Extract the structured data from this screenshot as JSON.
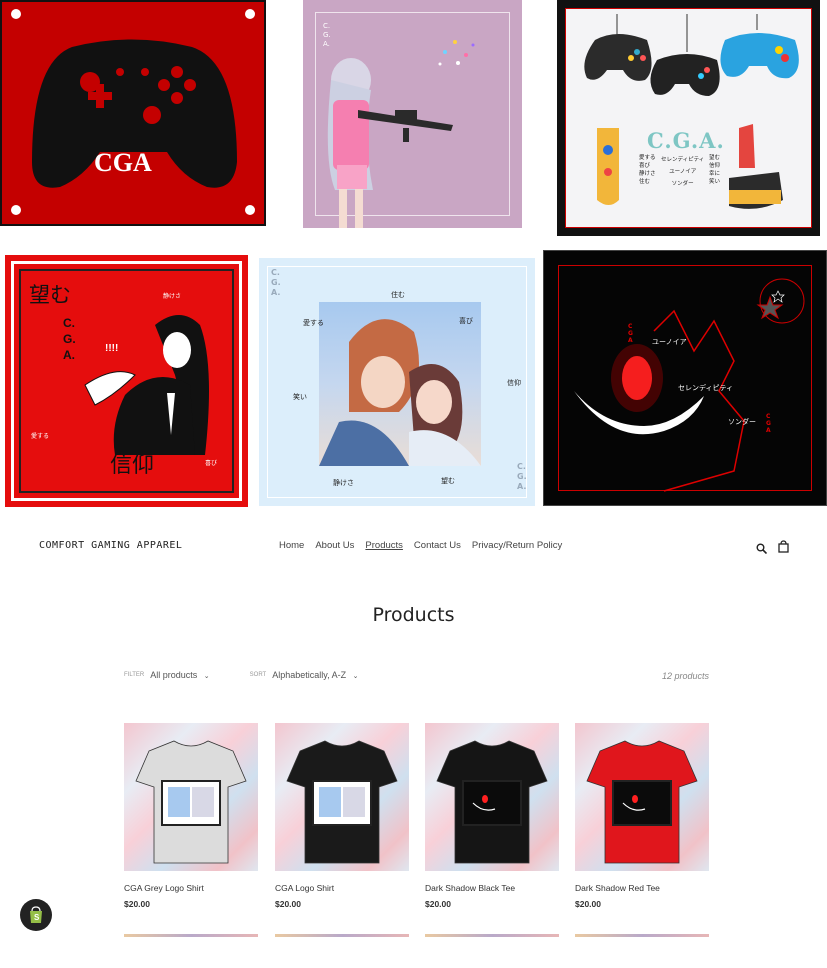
{
  "header": {
    "brand": "COMFORT GAMING APPAREL",
    "nav": [
      "Home",
      "About Us",
      "Products",
      "Contact Us",
      "Privacy/Return Policy"
    ],
    "active_nav": "Products"
  },
  "gallery": {
    "controller_logo": "CGA",
    "anime_girl_corner": "C.\nG.\nA.",
    "controllers_logo": "C.G.A.",
    "controllers_words_1": "愛する\n喜び\n静けさ\n住む",
    "controllers_words_2": "セレンディピティ\nユーノイア\nソンダー",
    "controllers_words_3": "望む\n信仰\n幸に\n笑い",
    "red_poster_kanji_top": "望む",
    "red_poster_kanji_bottom": "信仰",
    "red_poster_cga": "C.\nG.\nA.",
    "red_poster_exclaim": "!!!!",
    "red_poster_small1": "静けさ",
    "red_poster_small2": "愛する",
    "red_poster_small3": "喜び",
    "couple_words": [
      "住む",
      "愛する",
      "喜び",
      "笑い",
      "信仰",
      "静けさ",
      "望む"
    ],
    "couple_corner": "C.\nG.\nA.",
    "dark_words": [
      "ユーノイア",
      "セレンディピティ",
      "ソンダー"
    ],
    "dark_cga": "C\nG\nA"
  },
  "main": {
    "title": "Products",
    "filter_label": "FILTER",
    "filter_value": "All products",
    "sort_label": "SORT",
    "sort_value": "Alphabetically, A-Z",
    "count": "12 products",
    "products": [
      {
        "name": "CGA Grey Logo Shirt",
        "price": "$20.00",
        "shirt_color": "#dcdcdc"
      },
      {
        "name": "CGA Logo Shirt",
        "price": "$20.00",
        "shirt_color": "#1a1a1a"
      },
      {
        "name": "Dark Shadow Black Tee",
        "price": "$20.00",
        "shirt_color": "#151515"
      },
      {
        "name": "Dark Shadow Red Tee",
        "price": "$20.00",
        "shirt_color": "#e0161c"
      }
    ]
  },
  "shopify_badge": "shopify-bag-icon"
}
